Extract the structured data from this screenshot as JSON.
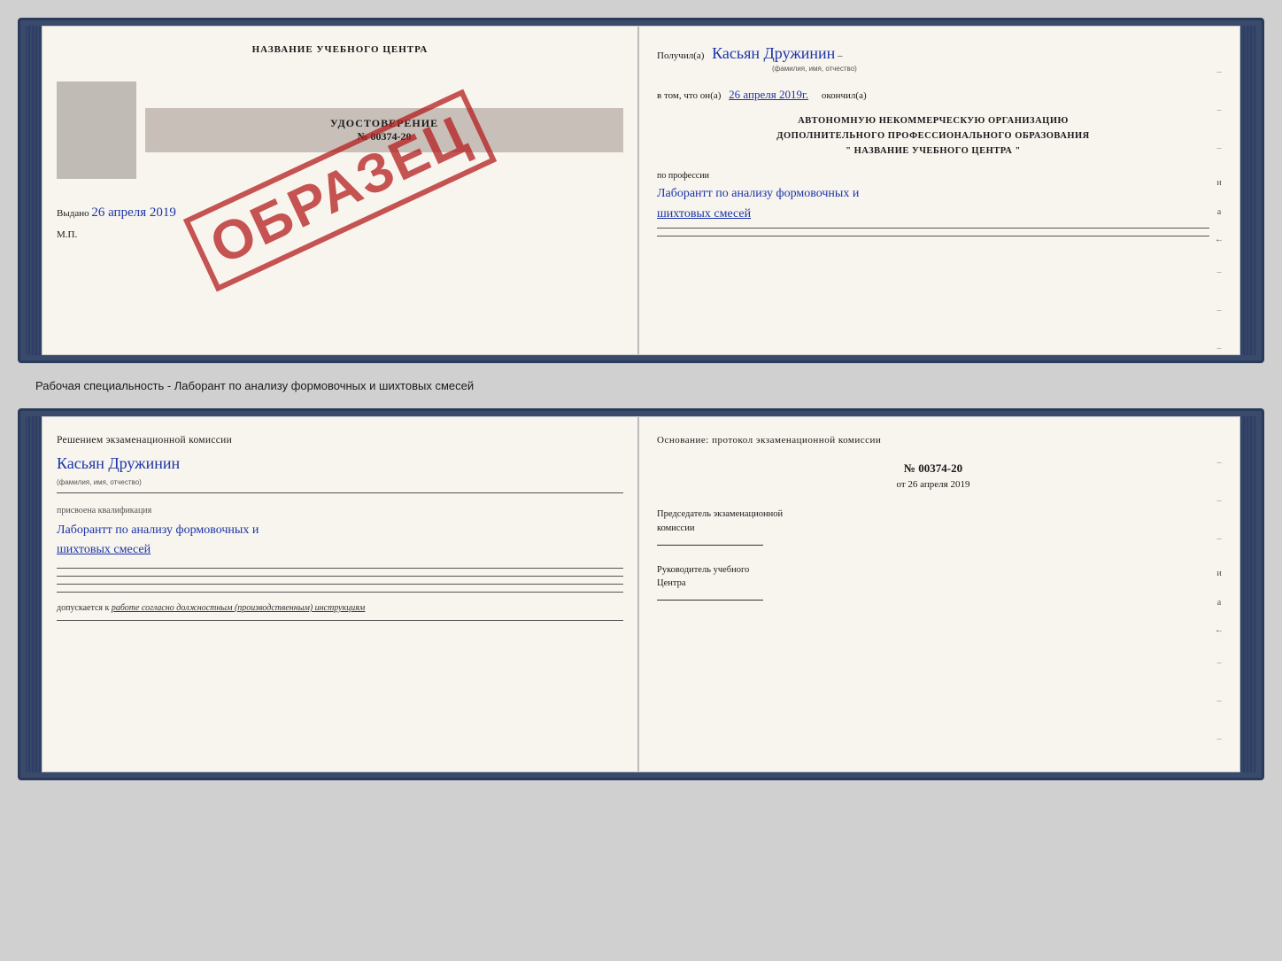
{
  "top_document": {
    "left": {
      "title": "НАЗВАНИЕ УЧЕБНОГО ЦЕНТРА",
      "cert_type": "УДОСТОВЕРЕНИЕ",
      "cert_number": "№ 00374-20",
      "issued_label": "Выдано",
      "issued_date": "26 апреля 2019",
      "mp_label": "М.П.",
      "stamp_text": "ОБРАЗЕЦ"
    },
    "right": {
      "received_label": "Получил(а)",
      "received_name": "Касьян Дружинин",
      "name_hint": "(фамилия, имя, отчество)",
      "in_that_label": "в том, что он(а)",
      "completion_date": "26 апреля 2019г.",
      "completed_label": "окончил(а)",
      "org_line1": "АВТОНОМНУЮ НЕКОММЕРЧЕСКУЮ ОРГАНИЗАЦИЮ",
      "org_line2": "ДОПОЛНИТЕЛЬНОГО ПРОФЕССИОНАЛЬНОГО ОБРАЗОВАНИЯ",
      "org_line3": "\"   НАЗВАНИЕ УЧЕБНОГО ЦЕНТРА   \"",
      "profession_label": "по профессии",
      "profession_name": "Лаборантт по анализу формовочных и шихтовых смесей",
      "side_items": [
        "–",
        "–",
        "–",
        "и",
        "а",
        "←",
        "–",
        "–",
        "–"
      ]
    }
  },
  "separator": {
    "text": "Рабочая специальность - Лаборант по анализу формовочных и шихтовых смесей"
  },
  "bottom_document": {
    "left": {
      "decision_label": "Решением экзаменационной комиссии",
      "name": "Касьян Дружинин",
      "name_hint": "(фамилия, имя, отчество)",
      "qual_assigned_label": "присвоена квалификация",
      "qual_name": "Лаборантт по анализу формовочных и шихтовых смесей",
      "allowed_prefix": "допускается к",
      "allowed_text": "работе согласно должностным (производственным) инструкциям"
    },
    "right": {
      "basis_label": "Основание: протокол экзаменационной комиссии",
      "protocol_number": "№ 00374-20",
      "protocol_date_prefix": "от",
      "protocol_date": "26 апреля 2019",
      "chairman_label": "Председатель экзаменационной",
      "chairman_label2": "комиссии",
      "director_label": "Руководитель учебного",
      "director_label2": "Центра",
      "side_items": [
        "–",
        "–",
        "–",
        "и",
        "а",
        "←",
        "–",
        "–",
        "–"
      ]
    }
  }
}
